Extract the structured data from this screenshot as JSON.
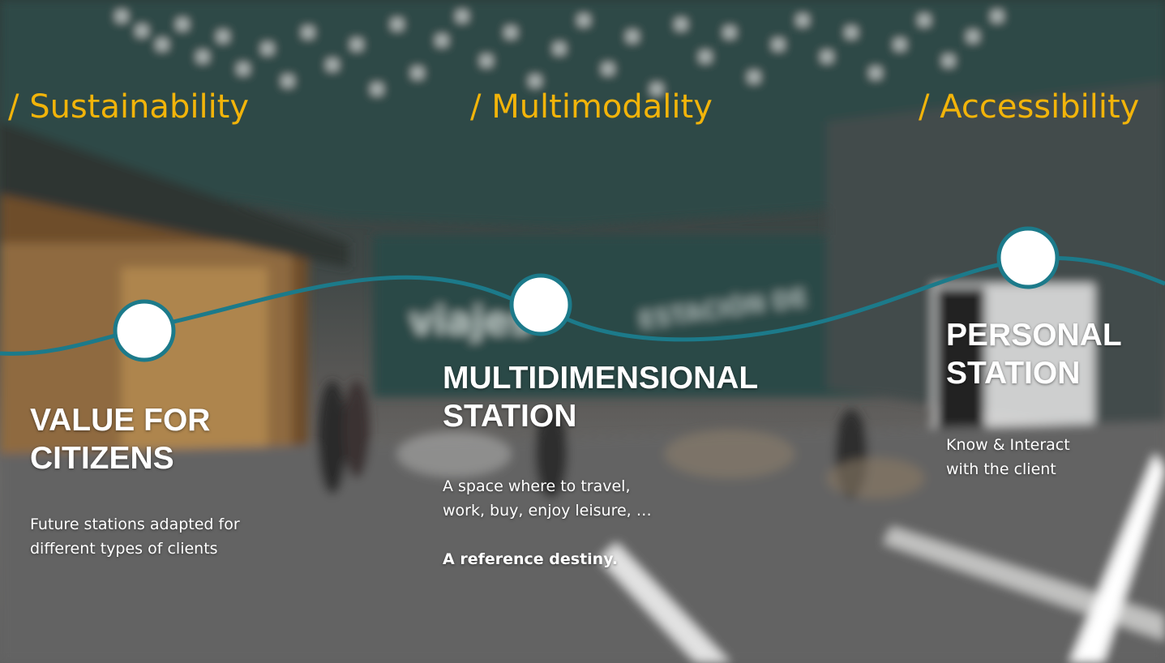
{
  "pillars": [
    "/ Sustainability",
    "/ Multimodality",
    "/ Accessibility"
  ],
  "stations": [
    {
      "heading_line1": "VALUE FOR",
      "heading_line2": "CITIZENS",
      "desc_line1": "Future stations adapted for",
      "desc_line2": "different types of clients"
    },
    {
      "heading_line1": "MULTIDIMENSIONAL",
      "heading_line2": "STATION",
      "desc_line1": "A space where to travel,",
      "desc_line2": "work, buy, enjoy leisure, …",
      "highlight": "A reference destiny."
    },
    {
      "heading_line1": "PERSONAL",
      "heading_line2": "STATION",
      "desc_line1": "Know & Interact",
      "desc_line2": "with the client"
    }
  ],
  "background_signage": [
    "viajes",
    "ESTACIÓN DE"
  ],
  "colors": {
    "pillar_text": "#f2b40a",
    "timeline": "#1c7a8a",
    "node_fill": "#ffffff",
    "heading_text": "#ffffff"
  }
}
